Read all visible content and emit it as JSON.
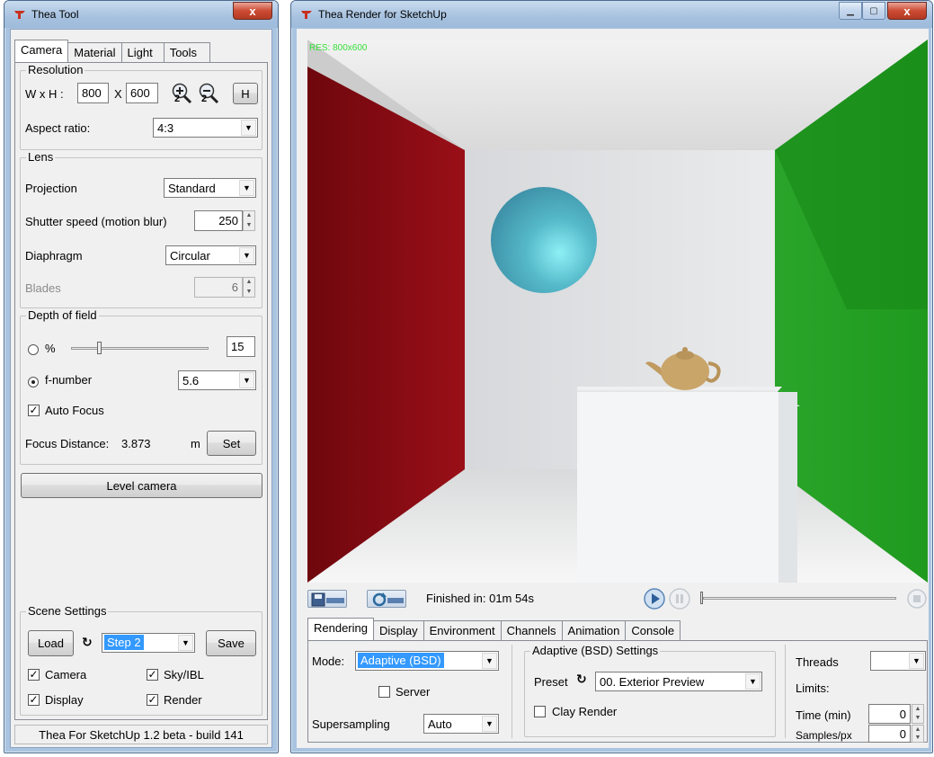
{
  "tool_window": {
    "title": "Thea Tool",
    "close_label": "x",
    "tabs": [
      {
        "label": "Camera"
      },
      {
        "label": "Material"
      },
      {
        "label": "Light"
      },
      {
        "label": "Tools"
      }
    ],
    "resolution": {
      "group_label": "Resolution",
      "wxh_label": "W x H :",
      "width": "800",
      "x_label": "X",
      "height": "600",
      "h_button": "H",
      "zoom_in_sub": "2",
      "zoom_out_sub": "2",
      "aspect_label": "Aspect ratio:",
      "aspect_value": "4:3"
    },
    "lens": {
      "group_label": "Lens",
      "projection_label": "Projection",
      "projection_value": "Standard",
      "shutter_label": "Shutter speed  (motion blur)",
      "shutter_value": "250",
      "diaphragm_label": "Diaphragm",
      "diaphragm_value": "Circular",
      "blades_label": "Blades",
      "blades_value": "6"
    },
    "dof": {
      "group_label": "Depth of field",
      "percent_label": "%",
      "percent_value": "15",
      "percent_slider_level": 0.2,
      "fnumber_label": "f-number",
      "fnumber_value": "5.6",
      "autofocus_label": "Auto Focus",
      "focus_distance_label": "Focus Distance:",
      "focus_distance_value": "3.873",
      "focus_unit": "m",
      "set_button": "Set"
    },
    "level_camera_button": "Level camera",
    "scene": {
      "group_label": "Scene Settings",
      "load_button": "Load",
      "step_value": "Step 2",
      "save_button": "Save",
      "camera_label": "Camera",
      "skyibl_label": "Sky/IBL",
      "display_label": "Display",
      "render_label": "Render"
    },
    "footer": "Thea For SketchUp 1.2 beta - build 141"
  },
  "render_window": {
    "title": "Thea Render for SketchUp",
    "res_label": "RES: 800x600",
    "status_text": "Finished in: 01m 54s",
    "tabs": [
      {
        "label": "Rendering"
      },
      {
        "label": "Display"
      },
      {
        "label": "Environment"
      },
      {
        "label": "Channels"
      },
      {
        "label": "Animation"
      },
      {
        "label": "Console"
      }
    ],
    "mode_label": "Mode:",
    "mode_value": "Adaptive (BSD)",
    "server_label": "Server",
    "supersampling_label": "Supersampling",
    "supersampling_value": "Auto",
    "adaptive_group_label": "Adaptive (BSD) Settings",
    "preset_label": "Preset",
    "preset_value": "00. Exterior Preview",
    "clay_label": "Clay Render",
    "threads_label": "Threads",
    "threads_value": "",
    "limits_label": "Limits:",
    "time_label": "Time (min)",
    "time_value": "0",
    "samples_label": "Samples/px",
    "samples_value": "0"
  },
  "colors": {
    "red_wall": "#8b0a12",
    "green_wall": "#1fa31f",
    "sphere": "#4fb6c6",
    "teapot": "#c9a56a",
    "res_text": "#39e03b",
    "selection": "#3399ff"
  }
}
